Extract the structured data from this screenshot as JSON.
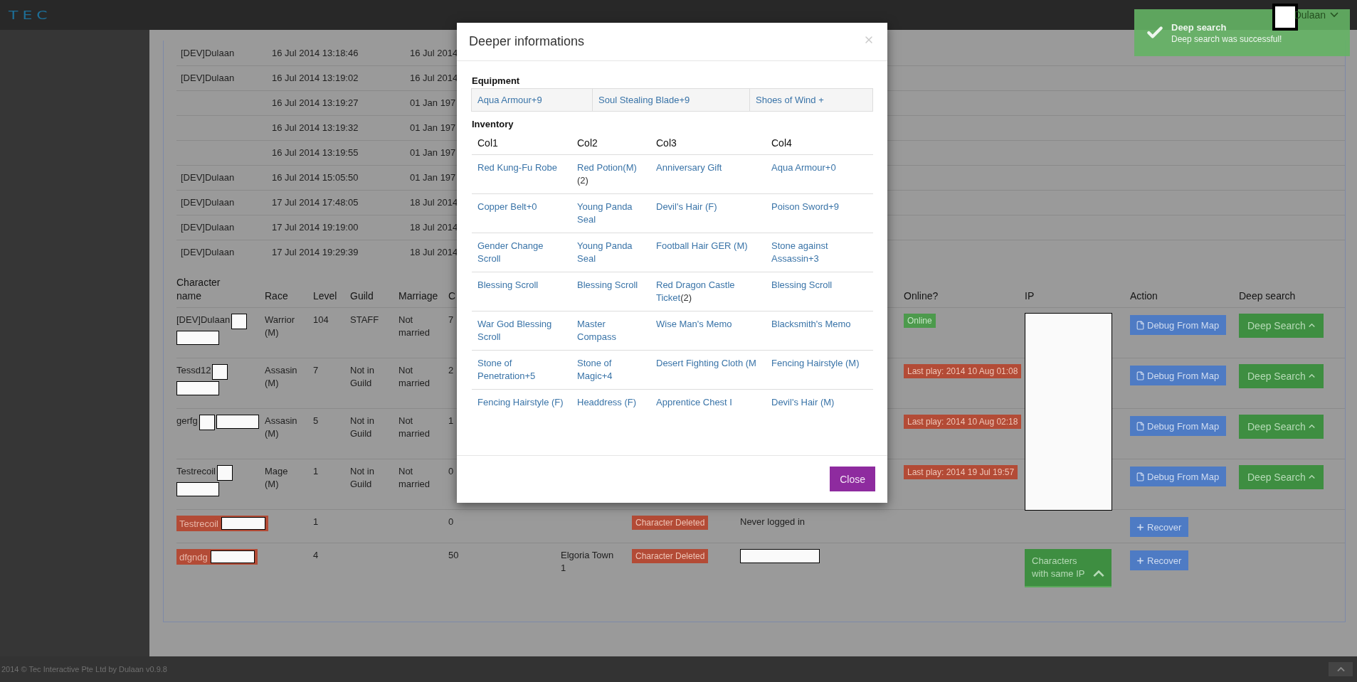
{
  "header": {
    "logo": "TEC",
    "user": "Dulaan"
  },
  "toast": {
    "title": "Deep search",
    "message": "Deep search was successful!"
  },
  "log_table": {
    "rows": [
      {
        "name": "[DEV]Dulaan",
        "created": "16 Jul 2014 13:18:46",
        "last": "16 Jul 2014"
      },
      {
        "name": "[DEV]Dulaan",
        "created": "16 Jul 2014 13:19:02",
        "last": "16 Jul 2014"
      },
      {
        "created": "16 Jul 2014 13:19:27",
        "last": "01 Jan 197"
      },
      {
        "created": "16 Jul 2014 13:19:32",
        "last": "01 Jan 197"
      },
      {
        "created": "16 Jul 2014 13:19:55",
        "last": "01 Jan 197"
      },
      {
        "name": "[DEV]Dulaan",
        "created": "16 Jul 2014 15:05:50",
        "last": "01 Jan 197"
      },
      {
        "name": "[DEV]Dulaan",
        "created": "17 Jul 2014 17:48:05",
        "last": "18 Jul 2014"
      },
      {
        "name": "[DEV]Dulaan",
        "created": "17 Jul 2014 19:19:00",
        "last": "18 Jul 2014"
      },
      {
        "name": "[DEV]Dulaan",
        "created": "17 Jul 2014 19:29:39",
        "last": "18 Jul 2014"
      }
    ]
  },
  "characters": {
    "headers": {
      "name": "Character name",
      "race": "Race",
      "level": "Level",
      "guild": "Guild",
      "marriage": "Marriage",
      "column_6": "C",
      "online": "Online?",
      "ip": "IP",
      "action": "Action",
      "deep_search": "Deep search"
    },
    "rows": [
      {
        "name": "[DEV]Dulaan",
        "deleted": false,
        "race": "Warrior (M)",
        "level": "104",
        "guild": "STAFF",
        "marriage": "Not married",
        "column_6": "7",
        "online": {
          "kind": "online",
          "text": "Online"
        },
        "action": {
          "kind": "debug",
          "label": "Debug From Map"
        },
        "deep_search": "Deep Search"
      },
      {
        "name": "Tessd12",
        "deleted": false,
        "race": "Assasin (M)",
        "level": "7",
        "guild": "Not in Guild",
        "marriage": "Not married",
        "column_6": "2",
        "online": {
          "kind": "last_play",
          "text": "Last play: 2014 10 Aug 01:08"
        },
        "action": {
          "kind": "debug",
          "label": "Debug From Map"
        },
        "deep_search": "Deep Search"
      },
      {
        "name": "gerfg",
        "deleted": false,
        "race": "Assasin (M)",
        "level": "5",
        "guild": "Not in Guild",
        "marriage": "Not married",
        "column_6": "1",
        "online": {
          "kind": "last_play",
          "text": "Last play: 2014 10 Aug 02:18"
        },
        "action": {
          "kind": "debug",
          "label": "Debug From Map"
        },
        "deep_search": "Deep Search"
      },
      {
        "name": "Testrecoil",
        "deleted": false,
        "race": "Mage (M)",
        "level": "1",
        "guild": "Not in Guild",
        "marriage": "Not married",
        "column_6": "0",
        "online": {
          "kind": "last_play",
          "text": "Last play: 2014 19 Jul 19:57"
        },
        "action": {
          "kind": "debug",
          "label": "Debug From Map"
        },
        "deep_search": "Deep Search"
      },
      {
        "name": "Testrecoil",
        "deleted": true,
        "level": "1",
        "column_6": "0",
        "status": "Character Deleted",
        "column_9": "Never logged in",
        "action": {
          "kind": "recover",
          "label": "Recover"
        }
      },
      {
        "name": "dfgndg",
        "deleted": true,
        "level": "4",
        "column_6": "50",
        "column_7": "Elgoria Town 1",
        "status": "Character Deleted",
        "redacted_cell": true,
        "ip_button": "Characters with same IP",
        "action": {
          "kind": "recover",
          "label": "Recover"
        }
      }
    ]
  },
  "modal": {
    "title": "Deeper informations",
    "equipment": {
      "label": "Equipment",
      "items": [
        "Aqua Armour+9",
        "Soul Stealing Blade+9",
        "Shoes of Wind +"
      ]
    },
    "inventory": {
      "label": "Inventory",
      "columns": [
        "Col1",
        "Col2",
        "Col3",
        "Col4"
      ],
      "rows": [
        [
          {
            "name": "Red Kung-Fu Robe"
          },
          {
            "name": "Red Potion(M)",
            "count": "(2)"
          },
          {
            "name": "Anniversary Gift"
          },
          {
            "name": "Aqua Armour+0"
          }
        ],
        [
          {
            "name": "Copper Belt+0"
          },
          {
            "name": "Young Panda Seal"
          },
          {
            "name": "Devil's Hair (F)"
          },
          {
            "name": "Poison Sword+9"
          }
        ],
        [
          {
            "name": "Gender Change Scroll"
          },
          {
            "name": "Young Panda Seal"
          },
          {
            "name": "Football Hair GER (M)"
          },
          {
            "name": "Stone against Assassin+3"
          }
        ],
        [
          {
            "name": "Blessing Scroll"
          },
          {
            "name": "Blessing Scroll"
          },
          {
            "name": "Red Dragon Castle Ticket",
            "count": "(2)"
          },
          {
            "name": "Blessing Scroll"
          }
        ],
        [
          {
            "name": "War God Blessing Scroll"
          },
          {
            "name": "Master Compass"
          },
          {
            "name": "Wise Man's Memo"
          },
          {
            "name": "Blacksmith's Memo"
          }
        ],
        [
          {
            "name": "Stone of Penetration+5"
          },
          {
            "name": "Stone of Magic+4"
          },
          {
            "name": "Desert Fighting Cloth (M"
          },
          {
            "name": "Fencing Hairstyle (M)"
          }
        ],
        [
          {
            "name": "Fencing Hairstyle (F)"
          },
          {
            "name": "Headdress (F)"
          },
          {
            "name": "Apprentice Chest I"
          },
          {
            "name": "Devil's Hair (M)"
          }
        ]
      ]
    },
    "close_button": "Close"
  },
  "footer": {
    "text": "2014 © Tec Interactive Pte Ltd by Dulaan v0.9.8"
  }
}
